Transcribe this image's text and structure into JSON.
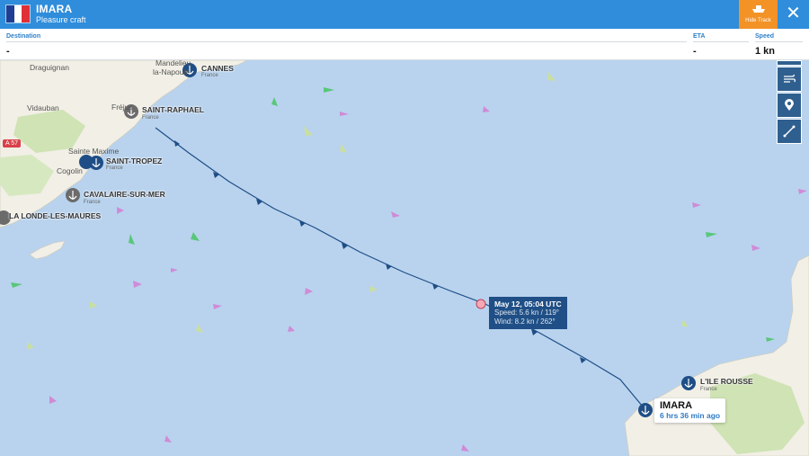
{
  "vessel": {
    "name": "IMARA",
    "type": "Pleasure craft",
    "flag": "France",
    "flag_colors": [
      "#1f3e93",
      "#ffffff",
      "#e12f37"
    ],
    "last_seen": "6 hrs 36 min ago"
  },
  "header": {
    "hide_track_label": "Hide Track",
    "close_icon": "close-icon",
    "bar_color": "#2f8ddb",
    "hide_track_color": "#f39225"
  },
  "info": {
    "destination_label": "Destination",
    "destination_value": "-",
    "eta_label": "ETA",
    "eta_value": "-",
    "speed_label": "Speed",
    "speed_value": "1 kn"
  },
  "tooltip": {
    "time": "May 12, 05:04 UTC",
    "speed": "Speed: 5.6 kn / 119°",
    "wind": "Wind: 8.2 kn / 262°"
  },
  "tools": [
    "layers-icon",
    "wind-icon",
    "location-pin-icon",
    "ruler-icon"
  ],
  "ports": [
    {
      "name": "CANNES",
      "country": "France"
    },
    {
      "name": "SAINT-RAPHAEL",
      "country": "France"
    },
    {
      "name": "SAINT-TROPEZ",
      "country": "France"
    },
    {
      "name": "CAVALAIRE-SUR-MER",
      "country": "France"
    },
    {
      "name": "LA LONDE-LES-MAURES",
      "country": ""
    },
    {
      "name": "L'ILE ROUSSE",
      "country": "France"
    }
  ],
  "places": [
    "Draguignan",
    "Vidauban",
    "Sainte Maxime",
    "Cogolin",
    "la-Napoule",
    "Mandelieu",
    "Fréjus"
  ],
  "road": "A 57"
}
